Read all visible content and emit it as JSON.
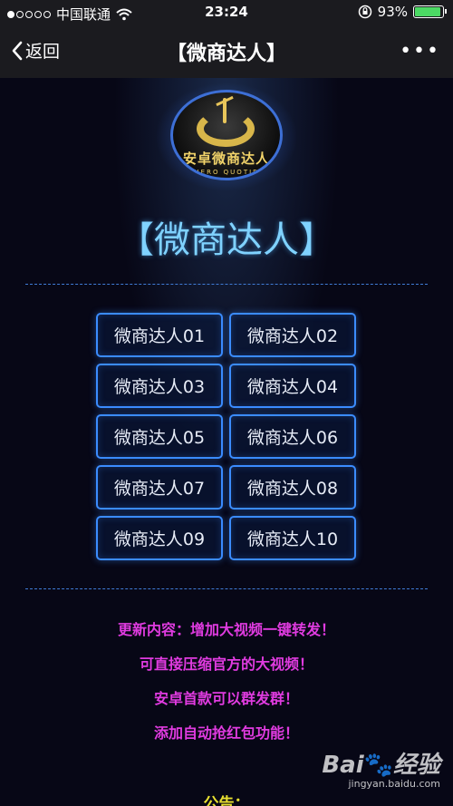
{
  "status_bar": {
    "carrier": "中国联通",
    "time": "23:24",
    "battery": "93%",
    "battery_level": 0.93,
    "signal_bars": 1
  },
  "nav": {
    "back_label": "返回",
    "title": "【微商达人】",
    "more_label": "•••"
  },
  "logo": {
    "text": "安卓微商达人",
    "subtext": "HERO QUOTIE"
  },
  "big_title": "【微商达人】",
  "buttons": [
    "微商达人01",
    "微商达人02",
    "微商达人03",
    "微商达人04",
    "微商达人05",
    "微商达人06",
    "微商达人07",
    "微商达人08",
    "微商达人09",
    "微商达人10"
  ],
  "updates": [
    "更新内容：增加大视频一键转发！",
    "可直接压缩官方的大视频！",
    "安卓首款可以群发群！",
    "添加自动抢红包功能！"
  ],
  "notice": "公告：",
  "watermark": {
    "main": "Bai",
    "main_suffix": "经验",
    "sub": "jingyan.baidu.com"
  },
  "colors": {
    "accent_blue": "#3b8cff",
    "title_cyan": "#7fd2ff",
    "update_magenta": "#e03be0",
    "notice_yellow": "#e8e030"
  }
}
